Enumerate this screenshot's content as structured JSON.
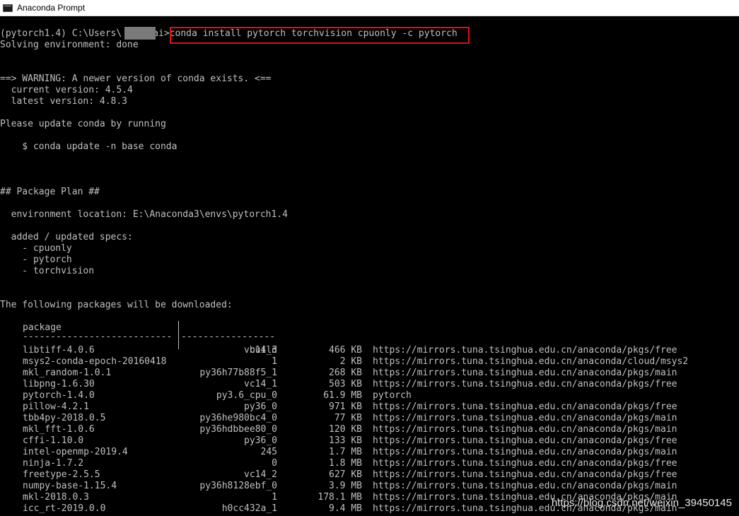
{
  "window": {
    "title": "Anaconda Prompt"
  },
  "console": {
    "prompt": "(pytorch1.4) C:\\Users\\",
    "prompt_suffix": "ai>",
    "command": "conda install pytorch torchvision cpuonly -c pytorch",
    "lines": [
      "Solving environment: done",
      "==> WARNING: A newer version of conda exists. <==",
      "  current version: 4.5.4",
      "  latest version: 4.8.3",
      "Please update conda by running",
      "    $ conda update -n base conda",
      "## Package Plan ##",
      "  environment location: E:\\Anaconda3\\envs\\pytorch1.4",
      "  added / updated specs:",
      "    - cpuonly",
      "    - pytorch",
      "    - torchvision",
      "The following packages will be downloaded:"
    ],
    "table": {
      "header_package": "package",
      "header_build": "build",
      "rule_package": "---------------------------",
      "rule_build": "-----------------",
      "rows": [
        {
          "name": "libtiff-4.0.6",
          "build": "vc14_3",
          "size": "466 KB",
          "channel": "https://mirrors.tuna.tsinghua.edu.cn/anaconda/pkgs/free"
        },
        {
          "name": "msys2-conda-epoch-20160418",
          "build": "1",
          "size": "2 KB",
          "channel": "https://mirrors.tuna.tsinghua.edu.cn/anaconda/cloud/msys2"
        },
        {
          "name": "mkl_random-1.0.1",
          "build": "py36h77b88f5_1",
          "size": "268 KB",
          "channel": "https://mirrors.tuna.tsinghua.edu.cn/anaconda/pkgs/main"
        },
        {
          "name": "libpng-1.6.30",
          "build": "vc14_1",
          "size": "503 KB",
          "channel": "https://mirrors.tuna.tsinghua.edu.cn/anaconda/pkgs/free"
        },
        {
          "name": "pytorch-1.4.0",
          "build": "py3.6_cpu_0",
          "size": "61.9 MB",
          "channel": "pytorch"
        },
        {
          "name": "pillow-4.2.1",
          "build": "py36_0",
          "size": "971 KB",
          "channel": "https://mirrors.tuna.tsinghua.edu.cn/anaconda/pkgs/free"
        },
        {
          "name": "tbb4py-2018.0.5",
          "build": "py36he980bc4_0",
          "size": "77 KB",
          "channel": "https://mirrors.tuna.tsinghua.edu.cn/anaconda/pkgs/main"
        },
        {
          "name": "mkl_fft-1.0.6",
          "build": "py36hdbbee80_0",
          "size": "120 KB",
          "channel": "https://mirrors.tuna.tsinghua.edu.cn/anaconda/pkgs/main"
        },
        {
          "name": "cffi-1.10.0",
          "build": "py36_0",
          "size": "133 KB",
          "channel": "https://mirrors.tuna.tsinghua.edu.cn/anaconda/pkgs/free"
        },
        {
          "name": "intel-openmp-2019.4",
          "build": "245",
          "size": "1.7 MB",
          "channel": "https://mirrors.tuna.tsinghua.edu.cn/anaconda/pkgs/main"
        },
        {
          "name": "ninja-1.7.2",
          "build": "0",
          "size": "1.8 MB",
          "channel": "https://mirrors.tuna.tsinghua.edu.cn/anaconda/pkgs/free"
        },
        {
          "name": "freetype-2.5.5",
          "build": "vc14_2",
          "size": "627 KB",
          "channel": "https://mirrors.tuna.tsinghua.edu.cn/anaconda/pkgs/free"
        },
        {
          "name": "numpy-base-1.15.4",
          "build": "py36h8128ebf_0",
          "size": "3.9 MB",
          "channel": "https://mirrors.tuna.tsinghua.edu.cn/anaconda/pkgs/main"
        },
        {
          "name": "mkl-2018.0.3",
          "build": "1",
          "size": "178.1 MB",
          "channel": "https://mirrors.tuna.tsinghua.edu.cn/anaconda/pkgs/main"
        },
        {
          "name": "icc_rt-2019.0.0",
          "build": "h0cc432a_1",
          "size": "9.4 MB",
          "channel": "https://mirrors.tuna.tsinghua.edu.cn/anaconda/pkgs/main"
        }
      ]
    }
  },
  "watermark": "https://blog.csdn.net/weixin_39450145",
  "colors": {
    "console_bg": "#000000",
    "console_fg": "#c0c0c0",
    "highlight_box": "#e01010"
  }
}
